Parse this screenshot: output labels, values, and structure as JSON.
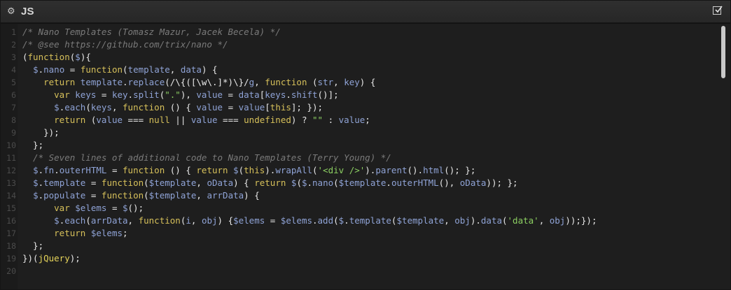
{
  "header": {
    "title": "JS",
    "settings_icon": "gear-icon",
    "toggle_icon": "checkbox-icon"
  },
  "editor": {
    "line_numbers": [
      "1",
      "2",
      "3",
      "4",
      "5",
      "6",
      "7",
      "8",
      "9",
      "10",
      "11",
      "12",
      "13",
      "14",
      "15",
      "16",
      "17",
      "18",
      "19",
      "20"
    ],
    "lines": [
      "/* Nano Templates (Tomasz Mazur, Jacek Becela) */",
      "/* @see https://github.com/trix/nano */",
      "(function($){",
      "  $.nano = function(template, data) {",
      "    return template.replace(/\\{([\\w\\.]*)\\}/g, function (str, key) {",
      "      var keys = key.split(\".\"), value = data[keys.shift()];",
      "      $.each(keys, function () { value = value[this]; });",
      "      return (value === null || value === undefined) ? \"\" : value;",
      "    });",
      "  };",
      "  /* Seven lines of additional code to Nano Templates (Terry Young) */",
      "  $.fn.outerHTML = function () { return $(this).wrapAll('<div />').parent().html(); };",
      "  $.template = function($template, oData) { return $($.nano($template.outerHTML(), oData)); };",
      "  $.populate = function($template, arrData) {",
      "      var $elems = $();",
      "      $.each(arrData, function(i, obj) {$elems = $elems.add($.template($template, obj).data('data', obj));});",
      "      return $elems;",
      "  };",
      "})(jQuery);",
      ""
    ]
  },
  "colors": {
    "background": "#1e1e1e",
    "comment": "#7a7a7a",
    "keyword": "#d6c05a",
    "variable": "#8fa3d6",
    "string": "#8ccf62"
  }
}
